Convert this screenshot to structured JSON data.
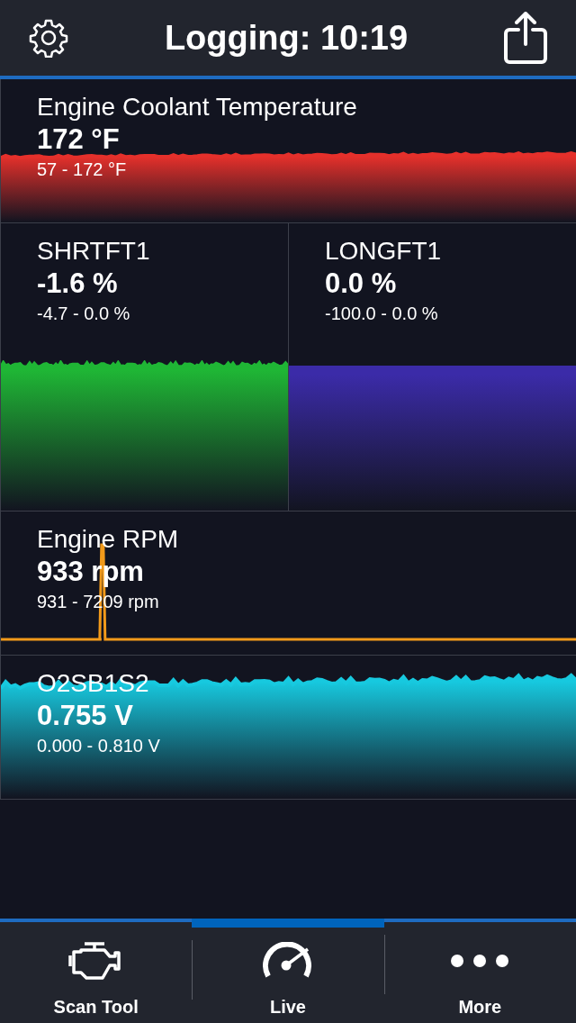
{
  "header": {
    "title": "Logging: 10:19"
  },
  "rows": [
    [
      {
        "name": "Engine Coolant Temperature",
        "value": "172 °F",
        "range": "57 - 172 °F",
        "color": "#e5302b",
        "kind": "area"
      }
    ],
    [
      {
        "name": "SHRTFT1",
        "value": "-1.6 %",
        "range": "-4.7 - 0.0 %",
        "color": "#1fb635",
        "kind": "area"
      },
      {
        "name": "LONGFT1",
        "value": "0.0 %",
        "range": "-100.0 - 0.0 %",
        "color": "#3b2ba8",
        "kind": "area"
      }
    ],
    [
      {
        "name": "Engine RPM",
        "value": "933 rpm",
        "range": "931 - 7209 rpm",
        "color": "#f29a1a",
        "kind": "line"
      }
    ],
    [
      {
        "name": "O2SB1S2",
        "value": "0.755 V",
        "range": "0.000 - 0.810 V",
        "color": "#17c9df",
        "kind": "area"
      }
    ]
  ],
  "tabs": [
    {
      "label": "Scan Tool",
      "selected": false
    },
    {
      "label": "Live",
      "selected": true
    },
    {
      "label": "More",
      "selected": false
    }
  ]
}
